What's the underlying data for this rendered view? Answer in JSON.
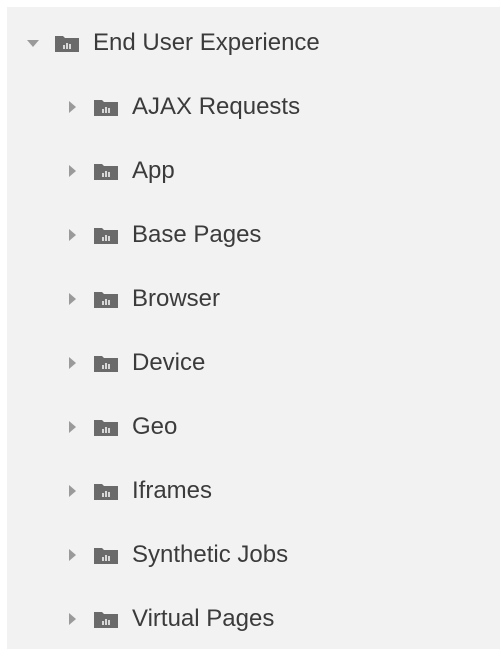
{
  "tree": {
    "root": {
      "label": "End User Experience",
      "expanded": true,
      "icon": "folder-chart-icon"
    },
    "children": [
      {
        "label": "AJAX Requests",
        "expanded": false
      },
      {
        "label": "App",
        "expanded": false
      },
      {
        "label": "Base Pages",
        "expanded": false
      },
      {
        "label": "Browser",
        "expanded": false
      },
      {
        "label": "Device",
        "expanded": false
      },
      {
        "label": "Geo",
        "expanded": false
      },
      {
        "label": "Iframes",
        "expanded": false
      },
      {
        "label": "Synthetic Jobs",
        "expanded": false
      },
      {
        "label": "Virtual Pages",
        "expanded": false
      }
    ]
  },
  "colors": {
    "panel_background": "#f2f2f2",
    "text": "#3b3b3b",
    "arrow": "#9a9a9a",
    "folder": "#6a6a6a"
  }
}
